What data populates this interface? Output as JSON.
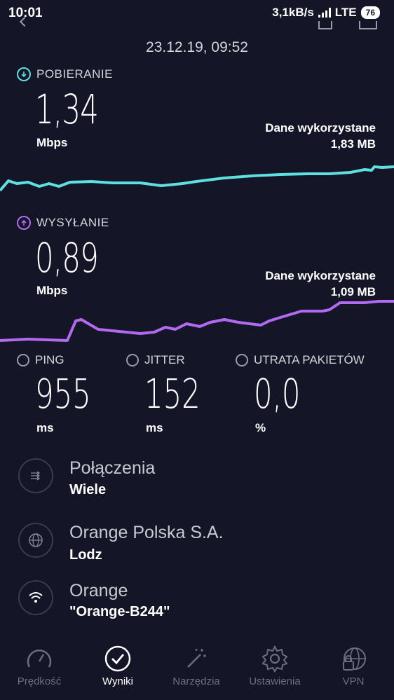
{
  "status_bar": {
    "time": "10:01",
    "speed": "3,1kB/s",
    "network": "LTE",
    "battery": "76"
  },
  "result": {
    "datetime": "23.12.19, 09:52",
    "download": {
      "label": "POBIERANIE",
      "value": "1,34",
      "unit": "Mbps",
      "data_used_label": "Dane wykorzystane",
      "data_used_value": "1,83 MB",
      "color": "#5fe0e0"
    },
    "upload": {
      "label": "WYSYŁANIE",
      "value": "0,89",
      "unit": "Mbps",
      "data_used_label": "Dane wykorzystane",
      "data_used_value": "1,09 MB",
      "color": "#b36af2"
    },
    "ping": {
      "label": "PING",
      "value": "955",
      "unit": "ms"
    },
    "jitter": {
      "label": "JITTER",
      "value": "152",
      "unit": "ms"
    },
    "packet_loss": {
      "label": "UTRATA PAKIETÓW",
      "value": "0,0",
      "unit": "%"
    }
  },
  "info": [
    {
      "icon": "connections-icon",
      "title": "Połączenia",
      "subtitle": "Wiele"
    },
    {
      "icon": "globe-icon",
      "title": "Orange Polska S.A.",
      "subtitle": "Lodz"
    },
    {
      "icon": "wifi-icon",
      "title": "Orange",
      "subtitle": "\"Orange-B244\""
    }
  ],
  "nav": [
    {
      "label": "Prędkość",
      "icon": "speedometer-icon",
      "active": false
    },
    {
      "label": "Wyniki",
      "icon": "check-circle-icon",
      "active": true
    },
    {
      "label": "Narzędzia",
      "icon": "magic-wand-icon",
      "active": false
    },
    {
      "label": "Ustawienia",
      "icon": "gear-icon",
      "active": false
    },
    {
      "label": "VPN",
      "icon": "vpn-lock-icon",
      "active": false
    }
  ]
}
